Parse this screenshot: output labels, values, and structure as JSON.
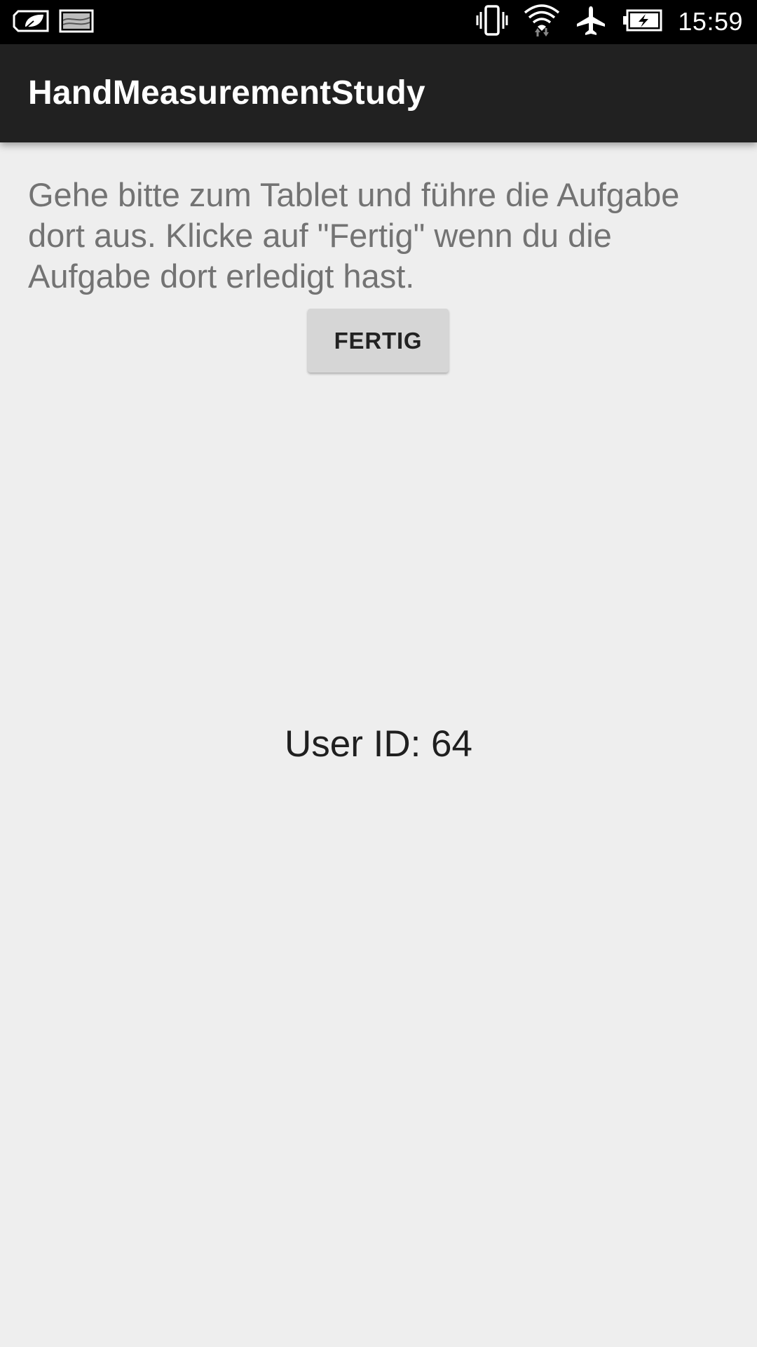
{
  "status_bar": {
    "time": "15:59",
    "icons": [
      "leaf-notification-icon",
      "image-notification-icon",
      "vibrate-icon",
      "wifi-icon",
      "airplane-mode-icon",
      "battery-charging-icon"
    ]
  },
  "toolbar": {
    "title": "HandMeasurementStudy"
  },
  "main": {
    "instruction": "Gehe bitte zum Tablet und führe die Aufgabe dort aus. Klicke auf \"Fertig\" wenn du die Aufgabe dort erledigt hast.",
    "done_button_label": "FERTIG",
    "user_id_text": "User ID: 64"
  },
  "colors": {
    "status_bar_bg": "#000000",
    "toolbar_bg": "#212121",
    "background": "#eeeeee",
    "button_bg": "#d6d6d6",
    "instruction_text": "#737373"
  }
}
